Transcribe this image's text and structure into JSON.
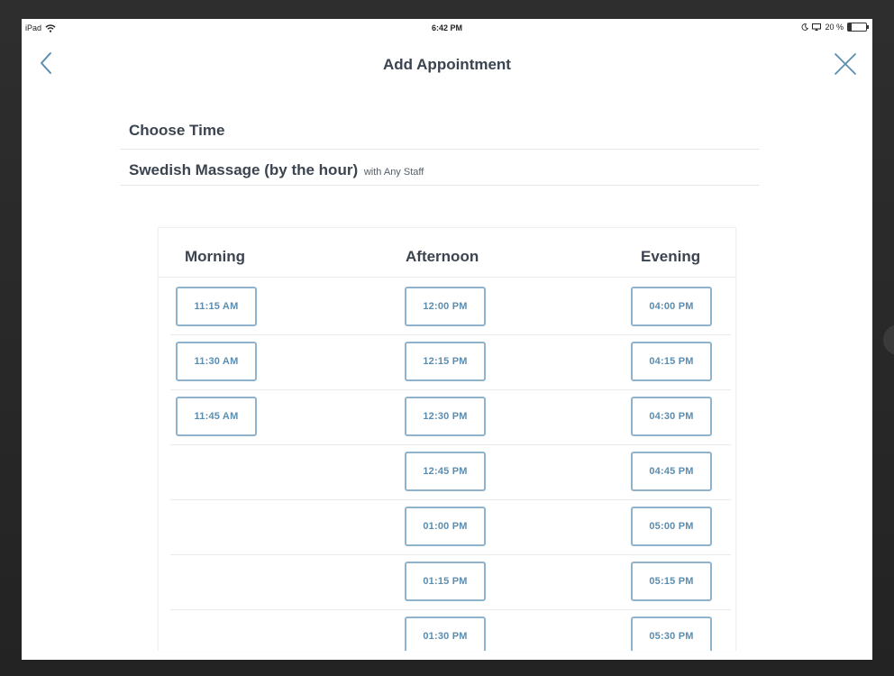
{
  "status_bar": {
    "device": "iPad",
    "time": "6:42 PM",
    "battery_text": "20 %",
    "battery_level": 0.2
  },
  "nav": {
    "title": "Add Appointment",
    "back_icon": "chevron-left-icon",
    "close_icon": "close-icon"
  },
  "section": {
    "choose_label": "Choose Time",
    "service_name": "Swedish Massage (by the hour)",
    "staff_text": "with Any Staff"
  },
  "columns": {
    "morning": {
      "label": "Morning",
      "slots": [
        "11:15 AM",
        "11:30 AM",
        "11:45 AM"
      ]
    },
    "afternoon": {
      "label": "Afternoon",
      "slots": [
        "12:00 PM",
        "12:15 PM",
        "12:30 PM",
        "12:45 PM",
        "01:00 PM",
        "01:15 PM",
        "01:30 PM"
      ]
    },
    "evening": {
      "label": "Evening",
      "slots": [
        "04:00 PM",
        "04:15 PM",
        "04:30 PM",
        "04:45 PM",
        "05:00 PM",
        "05:15 PM",
        "05:30 PM"
      ]
    }
  },
  "colors": {
    "accent": "#5b8db0",
    "border": "#8fb3cc",
    "heading": "#3c4450"
  }
}
